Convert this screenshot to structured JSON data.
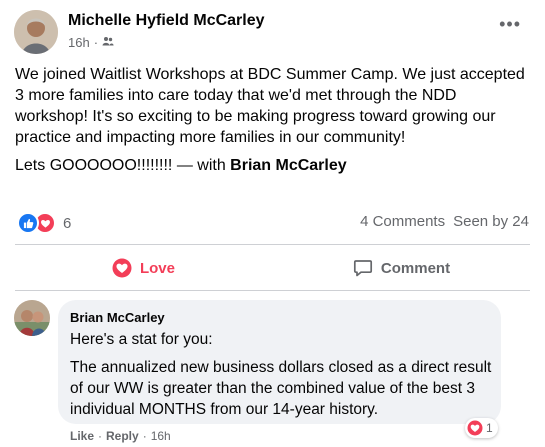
{
  "post": {
    "author": "Michelle Hyfield McCarley",
    "time": "16h",
    "separator": "·",
    "audience_icon": "friends-icon",
    "more_label": "•••",
    "paragraph_1": "We joined Waitlist Workshops at BDC Summer Camp. We just accepted 3 more families into care today that we'd met through the NDD workshop! It's so exciting to be making progress toward growing our practice and impacting more families in our community!",
    "paragraph_2_prefix": "Lets GOOOOOO!!!!!!!! — with ",
    "tagged_person": "Brian McCarley"
  },
  "reactions": {
    "icons": [
      "like-icon",
      "love-icon"
    ],
    "count": "6",
    "comments": "4 Comments",
    "seen_by": "Seen by 24",
    "colors": {
      "like": "#1877f2",
      "love": "#f33e58"
    }
  },
  "actions": {
    "love_label": "Love",
    "comment_label": "Comment"
  },
  "comment": {
    "author": "Brian McCarley",
    "line_1": "Here's a stat for you:",
    "line_2": "The annualized new business dollars closed as a direct result of our WW is greater than the combined value of the best 3 individual MONTHS from our 14-year history.",
    "reaction_count": "1",
    "like_label": "Like",
    "reply_label": "Reply",
    "separator": "·",
    "time": "16h"
  }
}
